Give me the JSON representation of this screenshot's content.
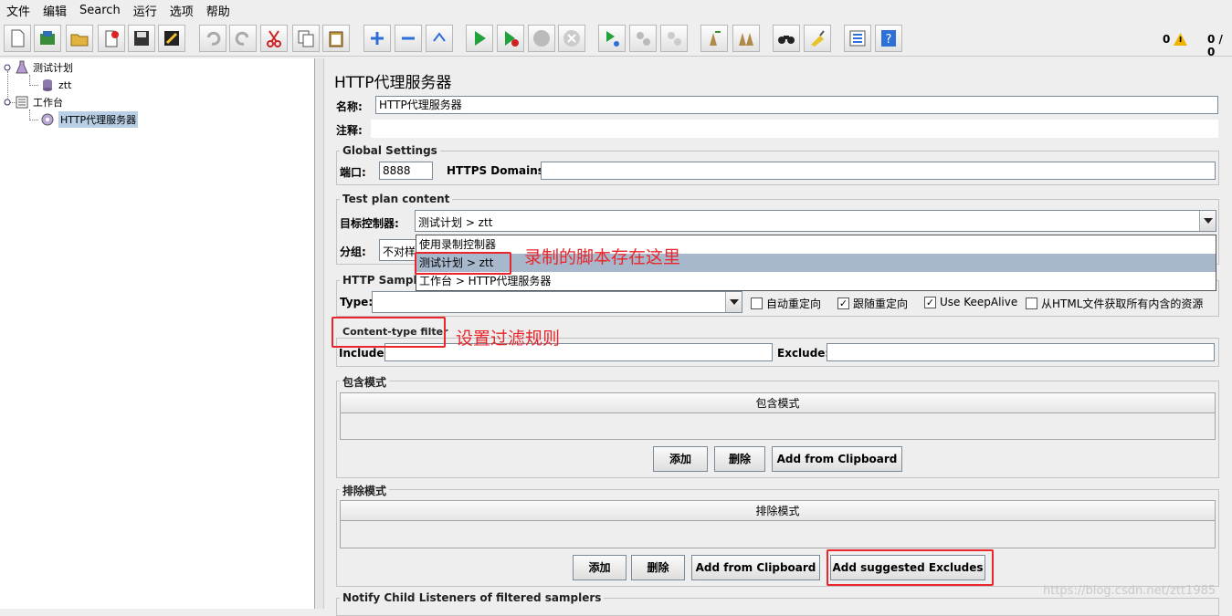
{
  "menu": [
    "文件",
    "编辑",
    "Search",
    "运行",
    "选项",
    "帮助"
  ],
  "toolbar_icons": [
    "new-icon",
    "templates-icon",
    "open-icon",
    "close-icon",
    "save-icon",
    "edit-icon",
    "undo-icon",
    "redo-icon",
    "cut-icon",
    "copy-icon",
    "paste-icon",
    "expand-icon",
    "collapse-icon",
    "toggle-icon",
    "run-icon",
    "run-no-pause-icon",
    "stop-icon",
    "shutdown-icon",
    "remote-start-icon",
    "remote-stop-icon",
    "remote-exit-icon",
    "clear-icon",
    "clear-all-icon",
    "search-icon",
    "reset-search-icon",
    "function-helper-icon",
    "help-icon"
  ],
  "status": {
    "warnings": "0",
    "threads": "0 / 0"
  },
  "tree": {
    "test_plan": "测试计划",
    "ztt": "ztt",
    "workbench": "工作台",
    "proxy": "HTTP代理服务器"
  },
  "panel": {
    "title": "HTTP代理服务器",
    "name_label": "名称:",
    "name_value": "HTTP代理服务器",
    "comment_label": "注释:",
    "global_settings": "Global Settings",
    "port_label": "端口:",
    "port_value": "8888",
    "https_label": "HTTPS Domains :",
    "test_plan_content": "Test plan content",
    "target_label": "目标控制器:",
    "target_value": "测试计划 > ztt",
    "grouping_label": "分组:",
    "grouping_value": "不对样",
    "dropdown_options": [
      "使用录制控制器",
      "测试计划 > ztt",
      "工作台 > HTTP代理服务器"
    ],
    "http_sampler": "HTTP Sampler",
    "type_label": "Type:",
    "checkboxes": [
      {
        "label": "自动重定向",
        "checked": false
      },
      {
        "label": "跟随重定向",
        "checked": true
      },
      {
        "label": "Use KeepAlive",
        "checked": true
      },
      {
        "label": "从HTML文件获取所有内含的资源",
        "checked": false
      }
    ],
    "content_filter": "Content-type filter",
    "include_label": "Include:",
    "exclude_label": "Exclude:",
    "include_patterns": "包含模式",
    "include_header": "包含模式",
    "exclude_patterns": "排除模式",
    "exclude_header": "排除模式",
    "add_btn": "添加",
    "delete_btn": "删除",
    "clipboard_btn": "Add from Clipboard",
    "suggested_btn": "Add suggested Excludes",
    "notify": "Notify Child Listeners of filtered samplers"
  },
  "annotations": {
    "script_saved": "录制的脚本存在这里",
    "filter_rules": "设置过滤规则"
  },
  "watermark": "https://blog.csdn.net/ztt1985"
}
